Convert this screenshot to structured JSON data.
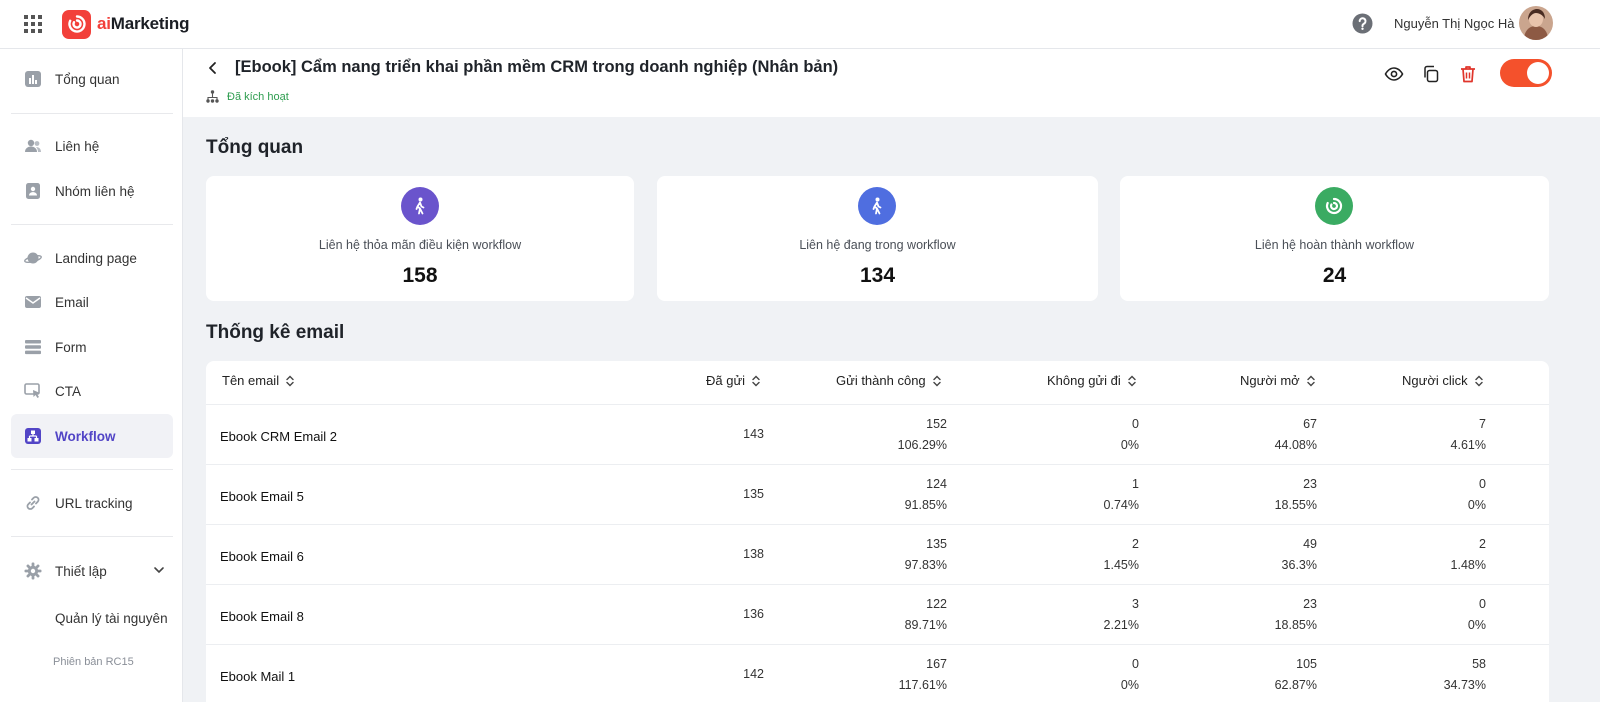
{
  "brand": {
    "prefix": "ai",
    "name": "Marketing"
  },
  "user": {
    "name": "Nguyễn Thị Ngọc Hà"
  },
  "sidebar": {
    "items": [
      {
        "label": "Tổng quan",
        "icon": "chart-icon"
      },
      {
        "label": "Liên hệ",
        "icon": "users-icon"
      },
      {
        "label": "Nhóm liên hệ",
        "icon": "contact-book-icon"
      },
      {
        "label": "Landing page",
        "icon": "planet-icon"
      },
      {
        "label": "Email",
        "icon": "mail-icon"
      },
      {
        "label": "Form",
        "icon": "form-icon"
      },
      {
        "label": "CTA",
        "icon": "cursor-click-icon"
      },
      {
        "label": "Workflow",
        "icon": "workflow-icon",
        "active": true
      },
      {
        "label": "URL tracking",
        "icon": "link-icon"
      },
      {
        "label": "Thiết lập",
        "icon": "gear-icon"
      }
    ],
    "sub_item": "Quản lý tài nguyên",
    "version": "Phiên bản RC15"
  },
  "header": {
    "title": "[Ebook] Cẩm nang triển khai phần mềm CRM trong doanh nghiệp (Nhân bản)",
    "status": "Đã kích hoạt",
    "toggle_on": true
  },
  "overview": {
    "title": "Tổng quan",
    "cards": [
      {
        "label": "Liên hệ thỏa mãn điều kiện workflow",
        "value": "158",
        "color": "#6a54cc",
        "icon": "walking-person-icon"
      },
      {
        "label": "Liên hệ đang trong workflow",
        "value": "134",
        "color": "#4f6ee0",
        "icon": "walking-person-icon"
      },
      {
        "label": "Liên hệ hoàn thành workflow",
        "value": "24",
        "color": "#3aab62",
        "icon": "complete-spiral-icon"
      }
    ]
  },
  "email_stats": {
    "title": "Thống kê email",
    "columns": [
      "Tên email",
      "Đã gửi",
      "Gửi thành công",
      "Không gửi đi",
      "Người mở",
      "Người click"
    ],
    "rows": [
      {
        "name": "Ebook CRM Email 2",
        "sent": "143",
        "success": "152",
        "success_pct": "106.29%",
        "failed": "0",
        "failed_pct": "0%",
        "opened": "67",
        "opened_pct": "44.08%",
        "clicked": "7",
        "clicked_pct": "4.61%"
      },
      {
        "name": "Ebook Email 5",
        "sent": "135",
        "success": "124",
        "success_pct": "91.85%",
        "failed": "1",
        "failed_pct": "0.74%",
        "opened": "23",
        "opened_pct": "18.55%",
        "clicked": "0",
        "clicked_pct": "0%"
      },
      {
        "name": "Ebook Email 6",
        "sent": "138",
        "success": "135",
        "success_pct": "97.83%",
        "failed": "2",
        "failed_pct": "1.45%",
        "opened": "49",
        "opened_pct": "36.3%",
        "clicked": "2",
        "clicked_pct": "1.48%"
      },
      {
        "name": "Ebook Email 8",
        "sent": "136",
        "success": "122",
        "success_pct": "89.71%",
        "failed": "3",
        "failed_pct": "2.21%",
        "opened": "23",
        "opened_pct": "18.85%",
        "clicked": "0",
        "clicked_pct": "0%"
      },
      {
        "name": "Ebook Mail 1",
        "sent": "142",
        "success": "167",
        "success_pct": "117.61%",
        "failed": "0",
        "failed_pct": "0%",
        "opened": "105",
        "opened_pct": "62.87%",
        "clicked": "58",
        "clicked_pct": "34.73%"
      }
    ]
  },
  "colors": {
    "accent": "#5245c6",
    "brand": "#f2403a",
    "toggle": "#f4512c",
    "status": "#2e9d4f",
    "delete": "#e0352b"
  }
}
